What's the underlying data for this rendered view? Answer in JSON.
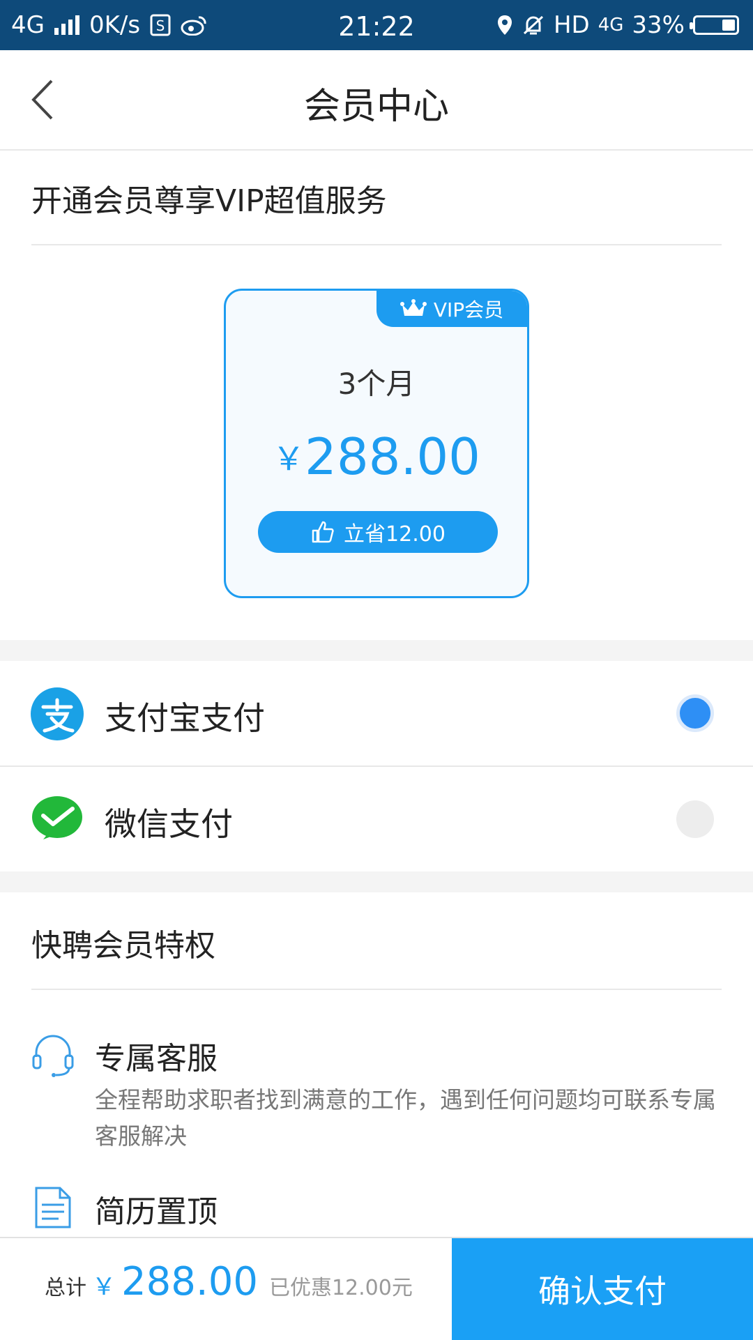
{
  "status_bar": {
    "network": "4G",
    "speed": "0K/s",
    "time": "21:22",
    "hd": "HD",
    "net_type": "4G",
    "battery": "33%",
    "icons": [
      "signal-icon",
      "sim-icon",
      "weibo-icon",
      "location-icon",
      "mute-icon",
      "battery-icon"
    ]
  },
  "header": {
    "title": "会员中心",
    "back_icon": "chevron-left-icon"
  },
  "intro": "开通会员尊享VIP超值服务",
  "plan": {
    "tag": "VIP会员",
    "period": "3个月",
    "currency": "￥",
    "price": "288.00",
    "save": "立省12.00",
    "accent": "#1d9cf0"
  },
  "payment": [
    {
      "label": "支付宝支付",
      "selected": true,
      "icon": "alipay-icon"
    },
    {
      "label": "微信支付",
      "selected": false,
      "icon": "wechat-icon"
    }
  ],
  "perks": {
    "title": "快聘会员特权",
    "items": [
      {
        "name": "专属客服",
        "desc": "全程帮助求职者找到满意的工作，遇到任何问题均可联系专属客服解决",
        "icon": "headset-icon"
      },
      {
        "name": "简历置顶",
        "desc": "",
        "icon": "document-icon"
      }
    ]
  },
  "footer": {
    "total_label": "总计",
    "currency": "￥",
    "total": "288.00",
    "discount": "已优惠12.00元",
    "confirm": "确认支付"
  }
}
